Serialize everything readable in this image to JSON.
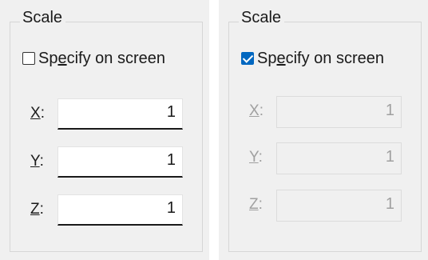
{
  "panels": [
    {
      "state": "enabled",
      "group_title": "Scale",
      "specify_checkbox": {
        "checked": false,
        "label_pre": "Sp",
        "label_mnemonic": "e",
        "label_post": "cify on screen"
      },
      "fields": [
        {
          "label_mnemonic": "X",
          "label_suffix": ":",
          "value": "1"
        },
        {
          "label_mnemonic": "Y",
          "label_suffix": ":",
          "value": "1"
        },
        {
          "label_mnemonic": "Z",
          "label_suffix": ":",
          "value": "1"
        }
      ]
    },
    {
      "state": "disabled",
      "group_title": "Scale",
      "specify_checkbox": {
        "checked": true,
        "label_pre": "Sp",
        "label_mnemonic": "e",
        "label_post": "cify on screen"
      },
      "fields": [
        {
          "label_mnemonic": "X",
          "label_suffix": ":",
          "value": "1"
        },
        {
          "label_mnemonic": "Y",
          "label_suffix": ":",
          "value": "1"
        },
        {
          "label_mnemonic": "Z",
          "label_suffix": ":",
          "value": "1"
        }
      ]
    }
  ],
  "colors": {
    "panel_bg": "#f0f0f0",
    "checkbox_checked": "#0067c0",
    "disabled_text": "#a0a0a0"
  }
}
